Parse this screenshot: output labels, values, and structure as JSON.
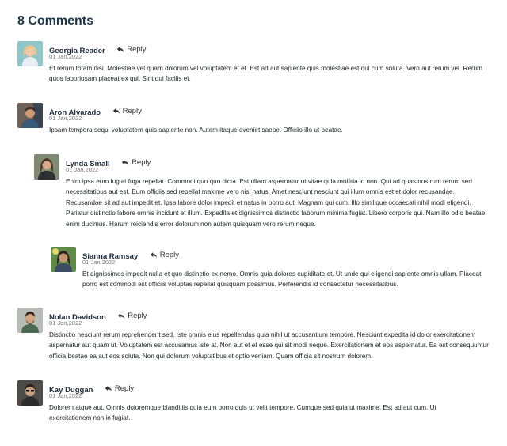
{
  "section": {
    "title": "8 Comments"
  },
  "reply_label": "Reply",
  "comments": [
    {
      "author": "Georgia Reader",
      "date": "01 Jan,2022",
      "text": "Et rerum totam nisi. Molestiae vel quam dolorum vel voluptatem et et. Est ad aut sapiente quis molestiae est qui cum soluta. Vero aut rerum vel. Rerum quos laboriosam placeat ex qui. Sint qui facilis et."
    },
    {
      "author": "Aron Alvarado",
      "date": "01 Jan,2022",
      "text": "Ipsam tempora sequi voluptatem quis sapiente non. Autem itaque eveniet saepe. Officiis illo ut beatae."
    },
    {
      "author": "Lynda Small",
      "date": "01 Jan,2022",
      "text": "Enim ipsa eum fugiat fuga repellat. Commodi quo quo dicta. Est ullam aspernatur ut vitae quia mollitia id non. Qui ad quas nostrum rerum sed necessitatibus aut est. Eum officiis sed repellat maxime vero nisi natus. Amet nesciunt nesciunt qui illum omnis est et dolor recusandae. Recusandae sit ad aut impedit et. Ipsa labore dolor impedit et natus in porro aut. Magnam qui cum. Illo similique occaecati nihil modi eligendi. Pariatur distinctio labore omnis incidunt et illum. Expedita et dignissimos distinctio laborum minima fugiat. Libero corporis qui. Nam illo odio beatae enim ducimus. Harum reiciendis error dolorum non autem quisquam vero rerum neque."
    },
    {
      "author": "Sianna Ramsay",
      "date": "01 Jan,2022",
      "text": "Et dignissimos impedit nulla et quo distinctio ex nemo. Omnis quia dolores cupiditate et. Ut unde qui eligendi sapiente omnis ullam. Placeat porro est commodi est officiis voluptas repellat quisquam possimus. Perferendis id consectetur necessitatibus."
    },
    {
      "author": "Nolan Davidson",
      "date": "01 Jan,2022",
      "text": "Distinctio nesciunt rerum reprehenderit sed. Iste omnis eius repellendus quia nihil ut accusantium tempore. Nesciunt expedita id dolor exercitationem aspernatur aut quam ut. Voluptatem est accusamus iste at. Non aut et et esse qui sit modi neque. Exercitationem et eos aspernatur. Ea est consequuntur officia beatae ea aut eos soluta. Non qui dolorum voluptatibus et optio veniam. Quam officia sit nostrum dolorem."
    },
    {
      "author": "Kay Duggan",
      "date": "01 Jan,2022",
      "text": "Dolorem atque aut. Omnis doloremque blanditiis quia eum porro quis ut velit tempore. Cumque sed quia ut maxime. Est ad aut cum. Ut exercitationem non in fugiat."
    }
  ]
}
